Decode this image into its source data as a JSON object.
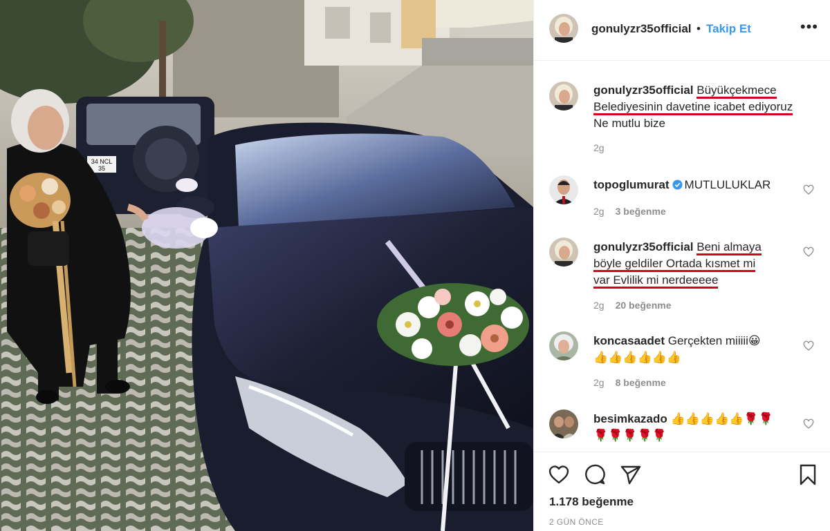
{
  "post": {
    "username": "gonulyzr35official",
    "separator": "•",
    "follow_label": "Takip Et",
    "more_label": "•••",
    "caption": {
      "username": "gonulyzr35official",
      "line1": "Büyükçekmece",
      "line2": "Belediyesinin davetine icabet ediyoruz",
      "line3": "Ne mutlu bize",
      "time": "2g"
    },
    "photo": {
      "license_plate_line1": "34 NCL",
      "license_plate_line2": "35"
    },
    "likes_text": "1.178 beğenme",
    "time_ago": "2 GÜN ÖNCE"
  },
  "comments": [
    {
      "username": "topoglumurat",
      "verified": true,
      "text": "MUTLULUKLAR",
      "time": "2g",
      "likes": "3 beğenme"
    },
    {
      "username": "gonulyzr35official",
      "line1": "Beni almaya",
      "line2": "böyle geldiler Ortada kısmet mi",
      "line3": "var Evlilik mi nerdeeeee",
      "time": "2g",
      "likes": "20 beğenme"
    },
    {
      "username": "koncasaadet",
      "text": "Gerçekten miiiii😀",
      "line2": "👍👍👍👍👍👍",
      "time": "2g",
      "likes": "8 beğenme"
    },
    {
      "username": "besimkazado",
      "text": "👍👍👍👍👍🌹🌹",
      "line2": "🌹🌹🌹🌹🌹"
    }
  ],
  "icons": {
    "like": "heart-icon",
    "comment": "comment-icon",
    "share": "paper-plane-icon",
    "save": "bookmark-icon"
  },
  "colors": {
    "link_blue": "#3897f0",
    "verified_blue": "#3897f0",
    "underline_red": "#d6001c",
    "meta_gray": "#8e8e8e"
  }
}
